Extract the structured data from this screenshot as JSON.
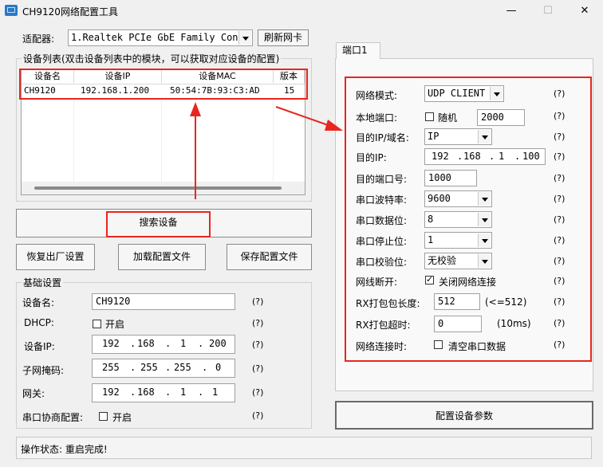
{
  "window": {
    "title": "CH9120网络配置工具",
    "minimize": "—",
    "maximize": "☐",
    "close": "✕"
  },
  "adapter": {
    "label": "适配器:",
    "value": "1.Realtek PCIe GbE Family Cont:",
    "refresh": "刷新网卡"
  },
  "device_list": {
    "title": "设备列表(双击设备列表中的模块，可以获取对应设备的配置)",
    "columns": [
      "设备名",
      "设备IP",
      "设备MAC",
      "版本"
    ],
    "rows": [
      {
        "name": "CH9120",
        "ip": "192.168.1.200",
        "mac": "50:54:7B:93:C3:AD",
        "version": "15"
      }
    ]
  },
  "buttons": {
    "search": "搜索设备",
    "restore": "恢复出厂设置",
    "load": "加载配置文件",
    "save": "保存配置文件",
    "configure": "配置设备参数"
  },
  "basic": {
    "title": "基础设置",
    "device_name_label": "设备名:",
    "device_name": "CH9120",
    "dhcp_label": "DHCP:",
    "dhcp_option": "开启",
    "ip_label": "设备IP:",
    "ip": [
      "192",
      "168",
      "1",
      "200"
    ],
    "mask_label": "子网掩码:",
    "mask": [
      "255",
      "255",
      "255",
      "0"
    ],
    "gateway_label": "网关:",
    "gateway": [
      "192",
      "168",
      "1",
      "1"
    ],
    "serial_label": "串口协商配置:",
    "serial_option": "开启",
    "help": "(?)"
  },
  "port_tab": "端口1",
  "port": {
    "mode_label": "网络模式:",
    "mode": "UDP CLIENT",
    "local_port_label": "本地端口:",
    "random_label": "随机",
    "local_port": "2000",
    "dest_type_label": "目的IP/域名:",
    "dest_type": "IP",
    "dest_ip_label": "目的IP:",
    "dest_ip": [
      "192",
      "168",
      "1",
      "100"
    ],
    "dest_port_label": "目的端口号:",
    "dest_port": "1000",
    "baud_label": "串口波特率:",
    "baud": "9600",
    "databits_label": "串口数据位:",
    "databits": "8",
    "stopbits_label": "串口停止位:",
    "stopbits": "1",
    "parity_label": "串口校验位:",
    "parity": "无校验",
    "disconnect_label": "网线断开:",
    "disconnect_option": "关闭网络连接",
    "rx_len_label": "RX打包包长度:",
    "rx_len": "512",
    "rx_len_hint": "(<=512)",
    "rx_timeout_label": "RX打包超时:",
    "rx_timeout": "0",
    "rx_timeout_unit": "(10ms)",
    "connect_label": "网络连接时:",
    "connect_option": "清空串口数据",
    "help": "(?)"
  },
  "status": {
    "text": "操作状态: 重启完成!"
  },
  "annotation_color": "#e8261f"
}
